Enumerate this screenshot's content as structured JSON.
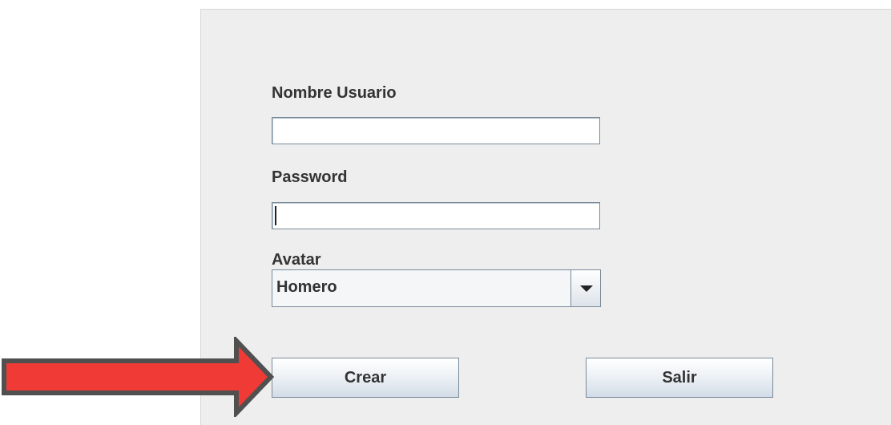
{
  "form": {
    "username_label": "Nombre Usuario",
    "username_value": "",
    "password_label": "Password",
    "password_value": "",
    "avatar_label": "Avatar",
    "avatar_selected": "Homero"
  },
  "buttons": {
    "create_label": "Crear",
    "exit_label": "Salir"
  },
  "annotation": {
    "arrow_color": "#f03a35",
    "arrow_outline_color": "#505050"
  },
  "icons": {
    "dropdown": "chevron-down-icon"
  }
}
